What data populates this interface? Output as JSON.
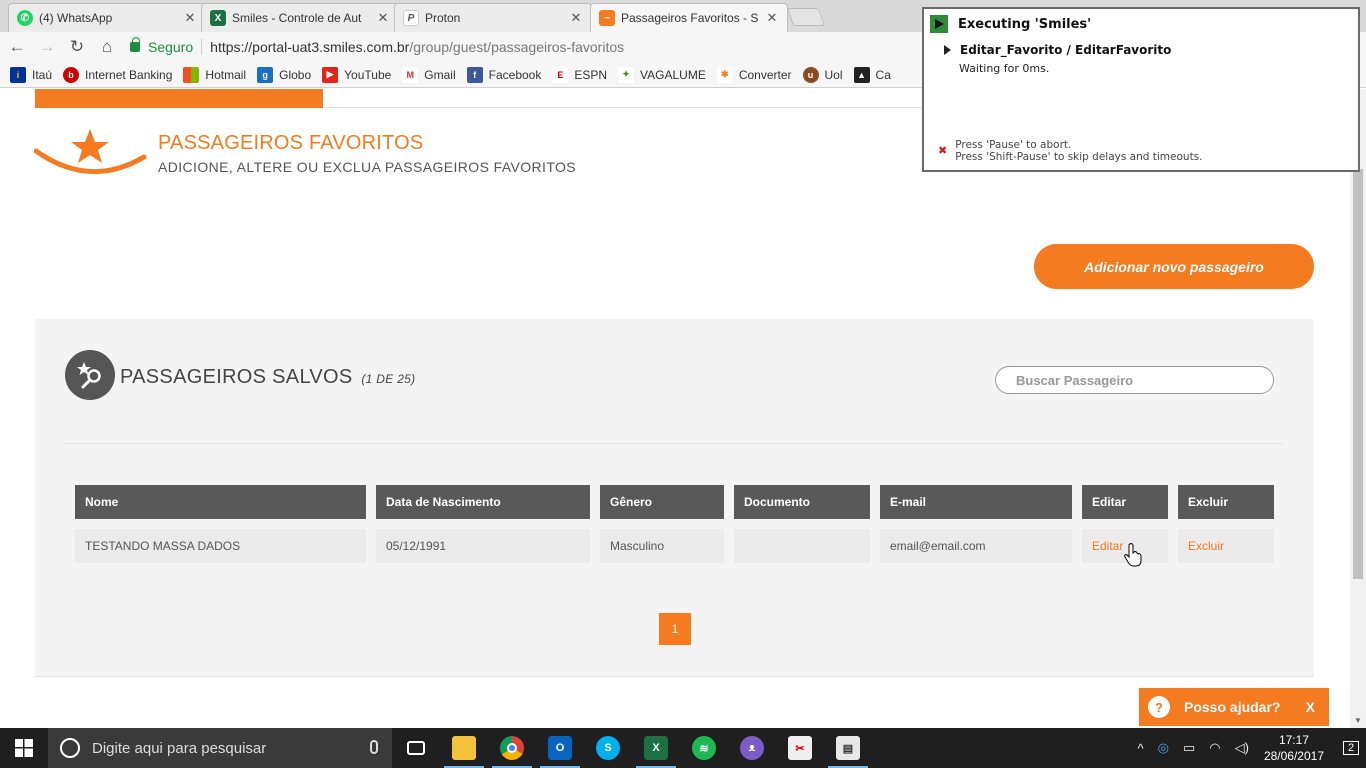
{
  "browser": {
    "tabs": [
      {
        "title": "(4) WhatsApp",
        "active": false
      },
      {
        "title": "Smiles - Controle de Aut",
        "active": false
      },
      {
        "title": "Proton",
        "active": false
      },
      {
        "title": "Passageiros Favoritos - S",
        "active": true
      }
    ],
    "tab_close": "✕",
    "secure_label": "Seguro",
    "url_domain": "https://portal-uat3.smiles.com.br",
    "url_path": "/group/guest/passageiros-favoritos",
    "bookmarks": [
      "Itaú",
      "Internet Banking",
      "Hotmail",
      "Globo",
      "YouTube",
      "Gmail",
      "Facebook",
      "ESPN",
      "VAGALUME",
      "Converter",
      "Uol",
      "Ca"
    ]
  },
  "page": {
    "title": "PASSAGEIROS FAVORITOS",
    "subtitle": "ADICIONE, ALTERE OU EXCLUA PASSAGEIROS FAVORITOS",
    "add_button": "Adicionar novo passageiro",
    "saved_title": "PASSAGEIROS SALVOS",
    "saved_count": "(1 DE 25)",
    "search_placeholder": "Buscar Passageiro",
    "table": {
      "headers": [
        "Nome",
        "Data de Nascimento",
        "Gênero",
        "Documento",
        "E-mail",
        "Editar",
        "Excluir"
      ],
      "rows": [
        [
          "TESTANDO MASSA DADOS",
          "05/12/1991",
          "Masculino",
          "",
          "email@email.com",
          "Editar",
          "Excluir"
        ]
      ]
    },
    "pagination": [
      "1"
    ],
    "help_label": "Posso ajudar?",
    "help_close": "X",
    "accent_color": "#f47b20"
  },
  "automation": {
    "title": "Executing 'Smiles'",
    "step": "Editar_Favorito / EditarFavorito",
    "status": "Waiting for 0ms.",
    "note_line1": "Press 'Pause' to abort.",
    "note_line2": "Press 'Shift-Pause' to skip delays and timeouts."
  },
  "taskbar": {
    "search_placeholder": "Digite aqui para pesquisar",
    "time": "17:17",
    "date": "28/06/2017",
    "notifications": "2"
  }
}
